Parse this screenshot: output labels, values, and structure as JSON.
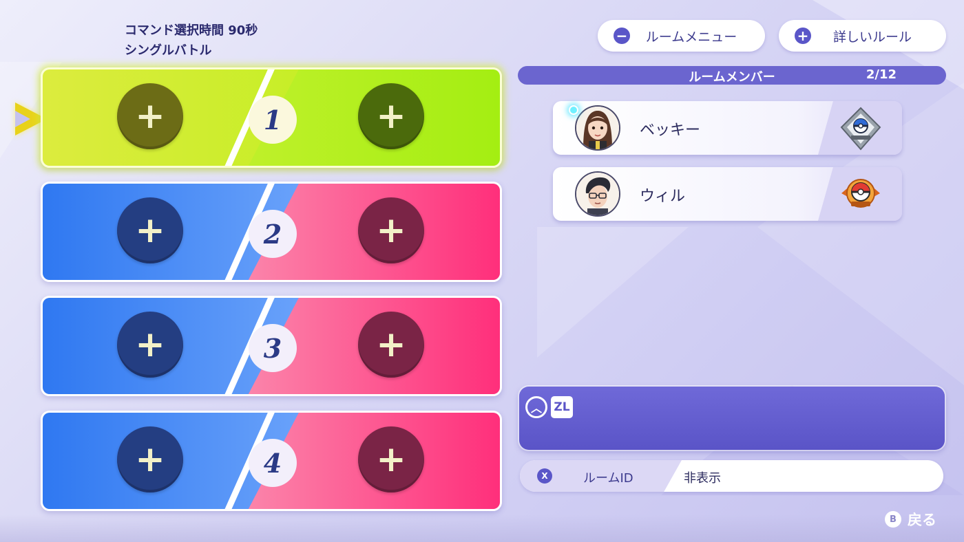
{
  "battle_info": {
    "time_limit": "コマンド選択時間 90秒",
    "battle_type": "シングルバトル"
  },
  "top_buttons": {
    "room_menu": {
      "icon": "minus-icon",
      "label": "ルームメニュー"
    },
    "detailed_rules": {
      "icon": "plus-icon",
      "label": "詳しいルール"
    }
  },
  "members": {
    "header": "ルームメンバー",
    "count": "2/12",
    "list": [
      {
        "name": "ベッキー",
        "badge": "great-ball-rank-badge"
      },
      {
        "name": "ウィル",
        "badge": "poke-ball-rank-badge"
      }
    ]
  },
  "teams": [
    {
      "number": "1",
      "active": true
    },
    {
      "number": "2",
      "active": false
    },
    {
      "number": "3",
      "active": false
    },
    {
      "number": "4",
      "active": false
    }
  ],
  "chat": {
    "up_icon": "chevron-up-icon",
    "zl_label": "ZL"
  },
  "room_id": {
    "button": "X",
    "label": "ルームID",
    "value": "非表示"
  },
  "back": {
    "button": "B",
    "label": "戻る"
  },
  "colors": {
    "active_slot": "#c5ee25",
    "blue_team": "#2f78f1",
    "pink_team": "#ff2f7b",
    "accent_purple": "#6b65cf"
  }
}
